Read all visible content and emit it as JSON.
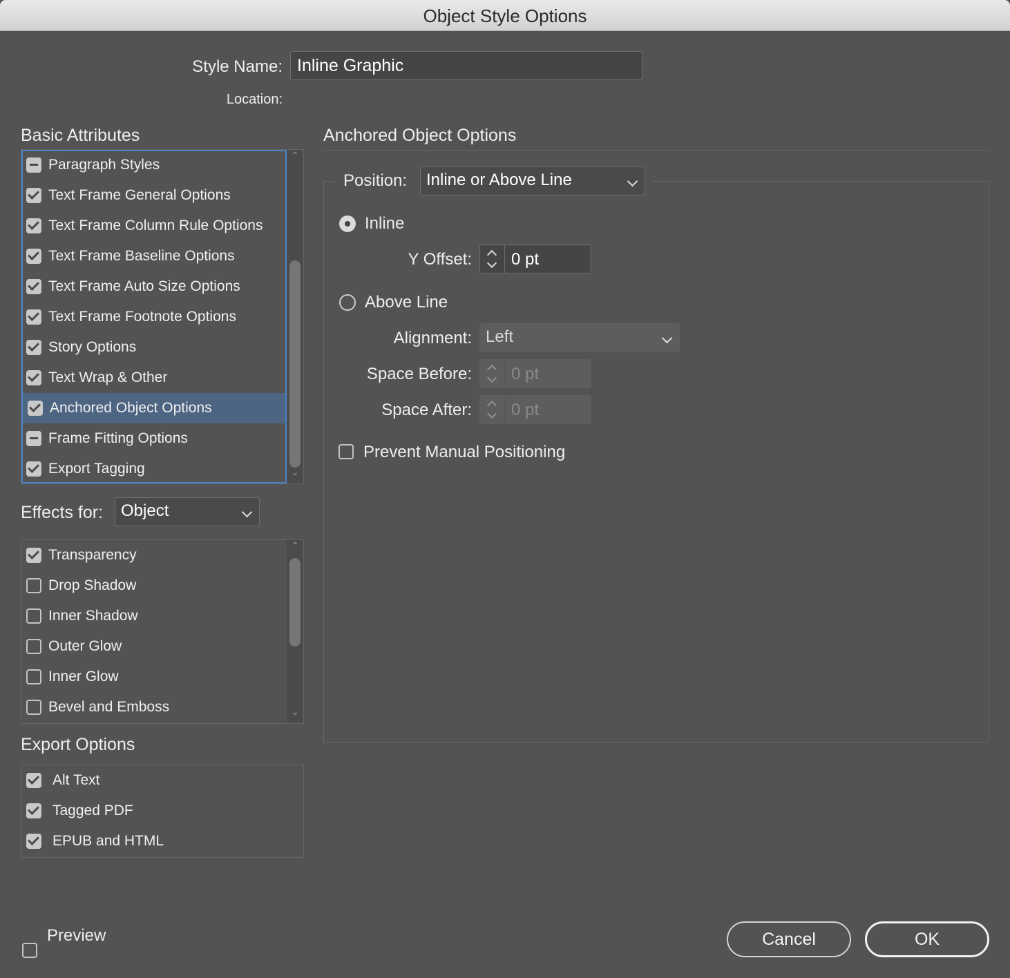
{
  "window": {
    "title": "Object Style Options"
  },
  "style_name": {
    "label": "Style Name:",
    "value": "Inline Graphic"
  },
  "location": {
    "label": "Location:"
  },
  "basic_attributes": {
    "title": "Basic Attributes",
    "items": [
      {
        "label": "Paragraph Styles",
        "state": "mixed"
      },
      {
        "label": "Text Frame General Options",
        "state": "checked"
      },
      {
        "label": "Text Frame Column Rule Options",
        "state": "checked"
      },
      {
        "label": "Text Frame Baseline Options",
        "state": "checked"
      },
      {
        "label": "Text Frame Auto Size Options",
        "state": "checked"
      },
      {
        "label": "Text Frame Footnote Options",
        "state": "checked"
      },
      {
        "label": "Story Options",
        "state": "checked"
      },
      {
        "label": "Text Wrap & Other",
        "state": "checked"
      },
      {
        "label": "Anchored Object Options",
        "state": "checked",
        "selected": true
      },
      {
        "label": "Frame Fitting Options",
        "state": "mixed"
      },
      {
        "label": "Export Tagging",
        "state": "checked"
      }
    ]
  },
  "effects": {
    "label": "Effects for:",
    "selected": "Object",
    "items": [
      {
        "label": "Transparency",
        "state": "checked"
      },
      {
        "label": "Drop Shadow",
        "state": "unchecked"
      },
      {
        "label": "Inner Shadow",
        "state": "unchecked"
      },
      {
        "label": "Outer Glow",
        "state": "unchecked"
      },
      {
        "label": "Inner Glow",
        "state": "unchecked"
      },
      {
        "label": "Bevel and Emboss",
        "state": "unchecked"
      }
    ]
  },
  "export_options": {
    "title": "Export Options",
    "items": [
      {
        "label": "Alt Text",
        "state": "checked"
      },
      {
        "label": "Tagged PDF",
        "state": "checked"
      },
      {
        "label": "EPUB and HTML",
        "state": "checked"
      }
    ]
  },
  "anchored": {
    "title": "Anchored Object Options",
    "position_label": "Position:",
    "position_value": "Inline or Above Line",
    "inline_label": "Inline",
    "inline_selected": true,
    "y_offset_label": "Y Offset:",
    "y_offset_value": "0 pt",
    "above_line_label": "Above Line",
    "alignment_label": "Alignment:",
    "alignment_value": "Left",
    "space_before_label": "Space Before:",
    "space_before_value": "0 pt",
    "space_after_label": "Space After:",
    "space_after_value": "0 pt",
    "prevent_label": "Prevent Manual Positioning",
    "prevent_checked": false
  },
  "footer": {
    "preview_label": "Preview",
    "preview_checked": false,
    "cancel_label": "Cancel",
    "ok_label": "OK"
  },
  "colors": {
    "background": "#535353",
    "selection": "#4d6582",
    "focus": "#4a82c6"
  },
  "icons": {
    "collapsed_selector": "chevron-down-icon",
    "stepper": "stepper-icon",
    "checkbox": "checkbox-icon",
    "radio": "radio-icon"
  }
}
